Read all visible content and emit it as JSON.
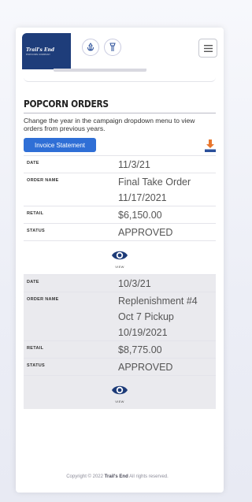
{
  "header": {
    "logo_line1": "Trail's End",
    "logo_line2": "POPCORN COMPANY",
    "icons": [
      "scout-symbol-icon",
      "cub-scout-symbol-icon",
      "hamburger-menu-icon"
    ]
  },
  "section": {
    "title": "POPCORN ORDERS",
    "description": "Change the year in the campaign dropdown menu to view orders from previous years.",
    "invoice_button_label": "Invoice Statement",
    "download_icon": "download-icon"
  },
  "labels": {
    "date": "DATE",
    "order_name": "ORDER NAME",
    "retail": "RETAIL",
    "status": "STATUS",
    "view": "VIEW"
  },
  "orders": [
    {
      "date": "11/3/21",
      "order_name_lines": [
        "Final Take Order",
        "11/17/2021"
      ],
      "retail": "$6,150.00",
      "status": "APPROVED"
    },
    {
      "date": "10/3/21",
      "order_name_lines": [
        "Replenishment #4",
        "Oct 7 Pickup",
        "10/19/2021"
      ],
      "retail": "$8,775.00",
      "status": "APPROVED"
    }
  ],
  "footer": {
    "prefix": "Copyright © 2022",
    "brand": "Trail's End",
    "suffix": "All rights reserved."
  },
  "colors": {
    "brand_navy": "#1e3d7a",
    "button_blue": "#2f6fd6",
    "download_orange": "#e8762d",
    "eye_navy": "#1d3b78"
  }
}
